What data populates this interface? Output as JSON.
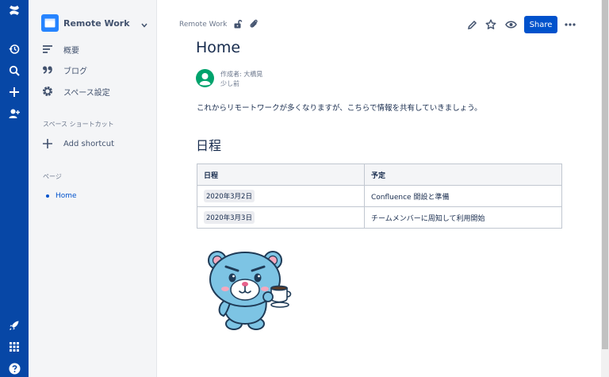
{
  "rail": {
    "icons": [
      "confluence-logo-icon",
      "recent-icon",
      "search-icon",
      "create-icon",
      "invite-people-icon",
      "rocket-icon",
      "app-switcher-icon",
      "help-icon"
    ],
    "accent": "#0747A6"
  },
  "sidebar": {
    "space_name": "Remote Work",
    "items": [
      {
        "label": "概要",
        "icon": "overview-icon"
      },
      {
        "label": "ブログ",
        "icon": "blog-quote-icon"
      },
      {
        "label": "スペース設定",
        "icon": "gear-icon"
      }
    ],
    "shortcuts_label": "スペース ショートカット",
    "add_shortcut_label": "Add shortcut",
    "pages_label": "ページ",
    "pages": [
      {
        "label": "Home"
      }
    ]
  },
  "header": {
    "breadcrumb": "Remote Work",
    "share_label": "Share",
    "brand_color": "#0052CC"
  },
  "page": {
    "title": "Home",
    "author_line": "作成者: 大橋晃",
    "time_line": "少し前",
    "intro": "これからリモートワークが多くなりますが、こちらで情報を共有していきましょう。",
    "section_heading": "日程",
    "table": {
      "headers": [
        "日程",
        "予定"
      ],
      "rows": [
        {
          "date": "2020年3月2日",
          "plan": "Confluence 開設と準備"
        },
        {
          "date": "2020年3月3日",
          "plan": "チームメンバーに周知して利用開始"
        }
      ]
    }
  }
}
